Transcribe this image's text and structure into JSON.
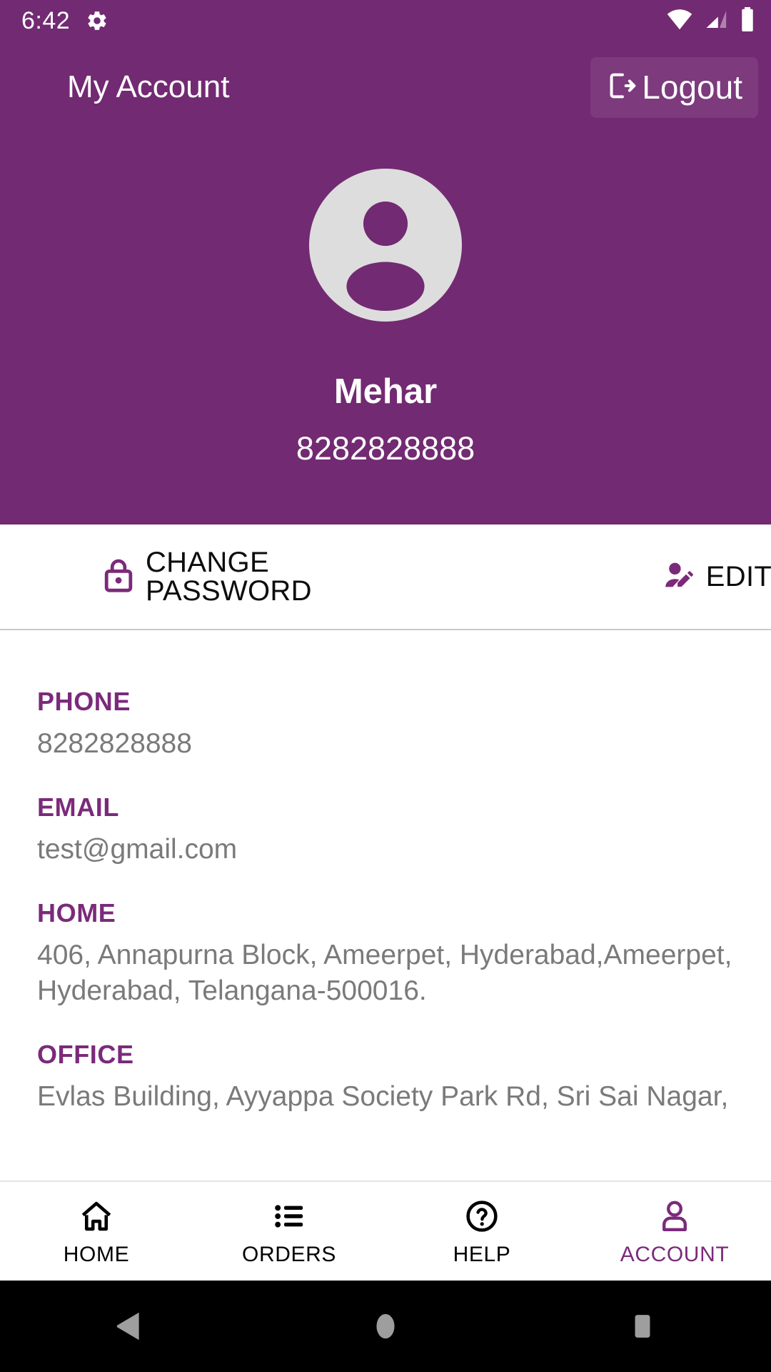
{
  "status_bar": {
    "clock": "6:42",
    "gear_icon": "gear-icon",
    "wifi_icon": "wifi-icon",
    "signal_icon": "cellular-signal-icon",
    "battery_icon": "battery-icon"
  },
  "app_bar": {
    "title": "My Account",
    "logout_label": "Logout",
    "logout_icon": "logout-icon"
  },
  "profile": {
    "avatar_icon": "account-circle-avatar",
    "name": "Mehar",
    "phone": "8282828888"
  },
  "actions": [
    {
      "label": "CHANGE PASSWORD",
      "icon": "lock-icon"
    },
    {
      "label": "EDIT",
      "icon": "edit-person-icon"
    }
  ],
  "details": [
    {
      "label": "PHONE",
      "value": "8282828888"
    },
    {
      "label": "EMAIL",
      "value": "test@gmail.com"
    },
    {
      "label": "HOME",
      "value": "406, Annapurna Block, Ameerpet, Hyderabad,Ameerpet, Hyderabad, Telangana-500016."
    },
    {
      "label": "OFFICE",
      "value": "Evlas Building, Ayyappa Society Park Rd, Sri Sai Nagar,"
    }
  ],
  "tabs": [
    {
      "label": "HOME",
      "icon": "home-icon",
      "active": false
    },
    {
      "label": "ORDERS",
      "icon": "list-icon",
      "active": false
    },
    {
      "label": "HELP",
      "icon": "help-icon",
      "active": false
    },
    {
      "label": "ACCOUNT",
      "icon": "person-icon",
      "active": true
    }
  ],
  "android_nav": {
    "back": "back-triangle-icon",
    "home": "home-circle-icon",
    "recents": "recents-square-icon"
  },
  "colors": {
    "brand_purple": "#722a72",
    "accent_purple": "#7b2a7b",
    "value_gray": "#7a7a7a",
    "avatar_gray": "#dddddd",
    "nav_gray": "#9e9e9e"
  }
}
